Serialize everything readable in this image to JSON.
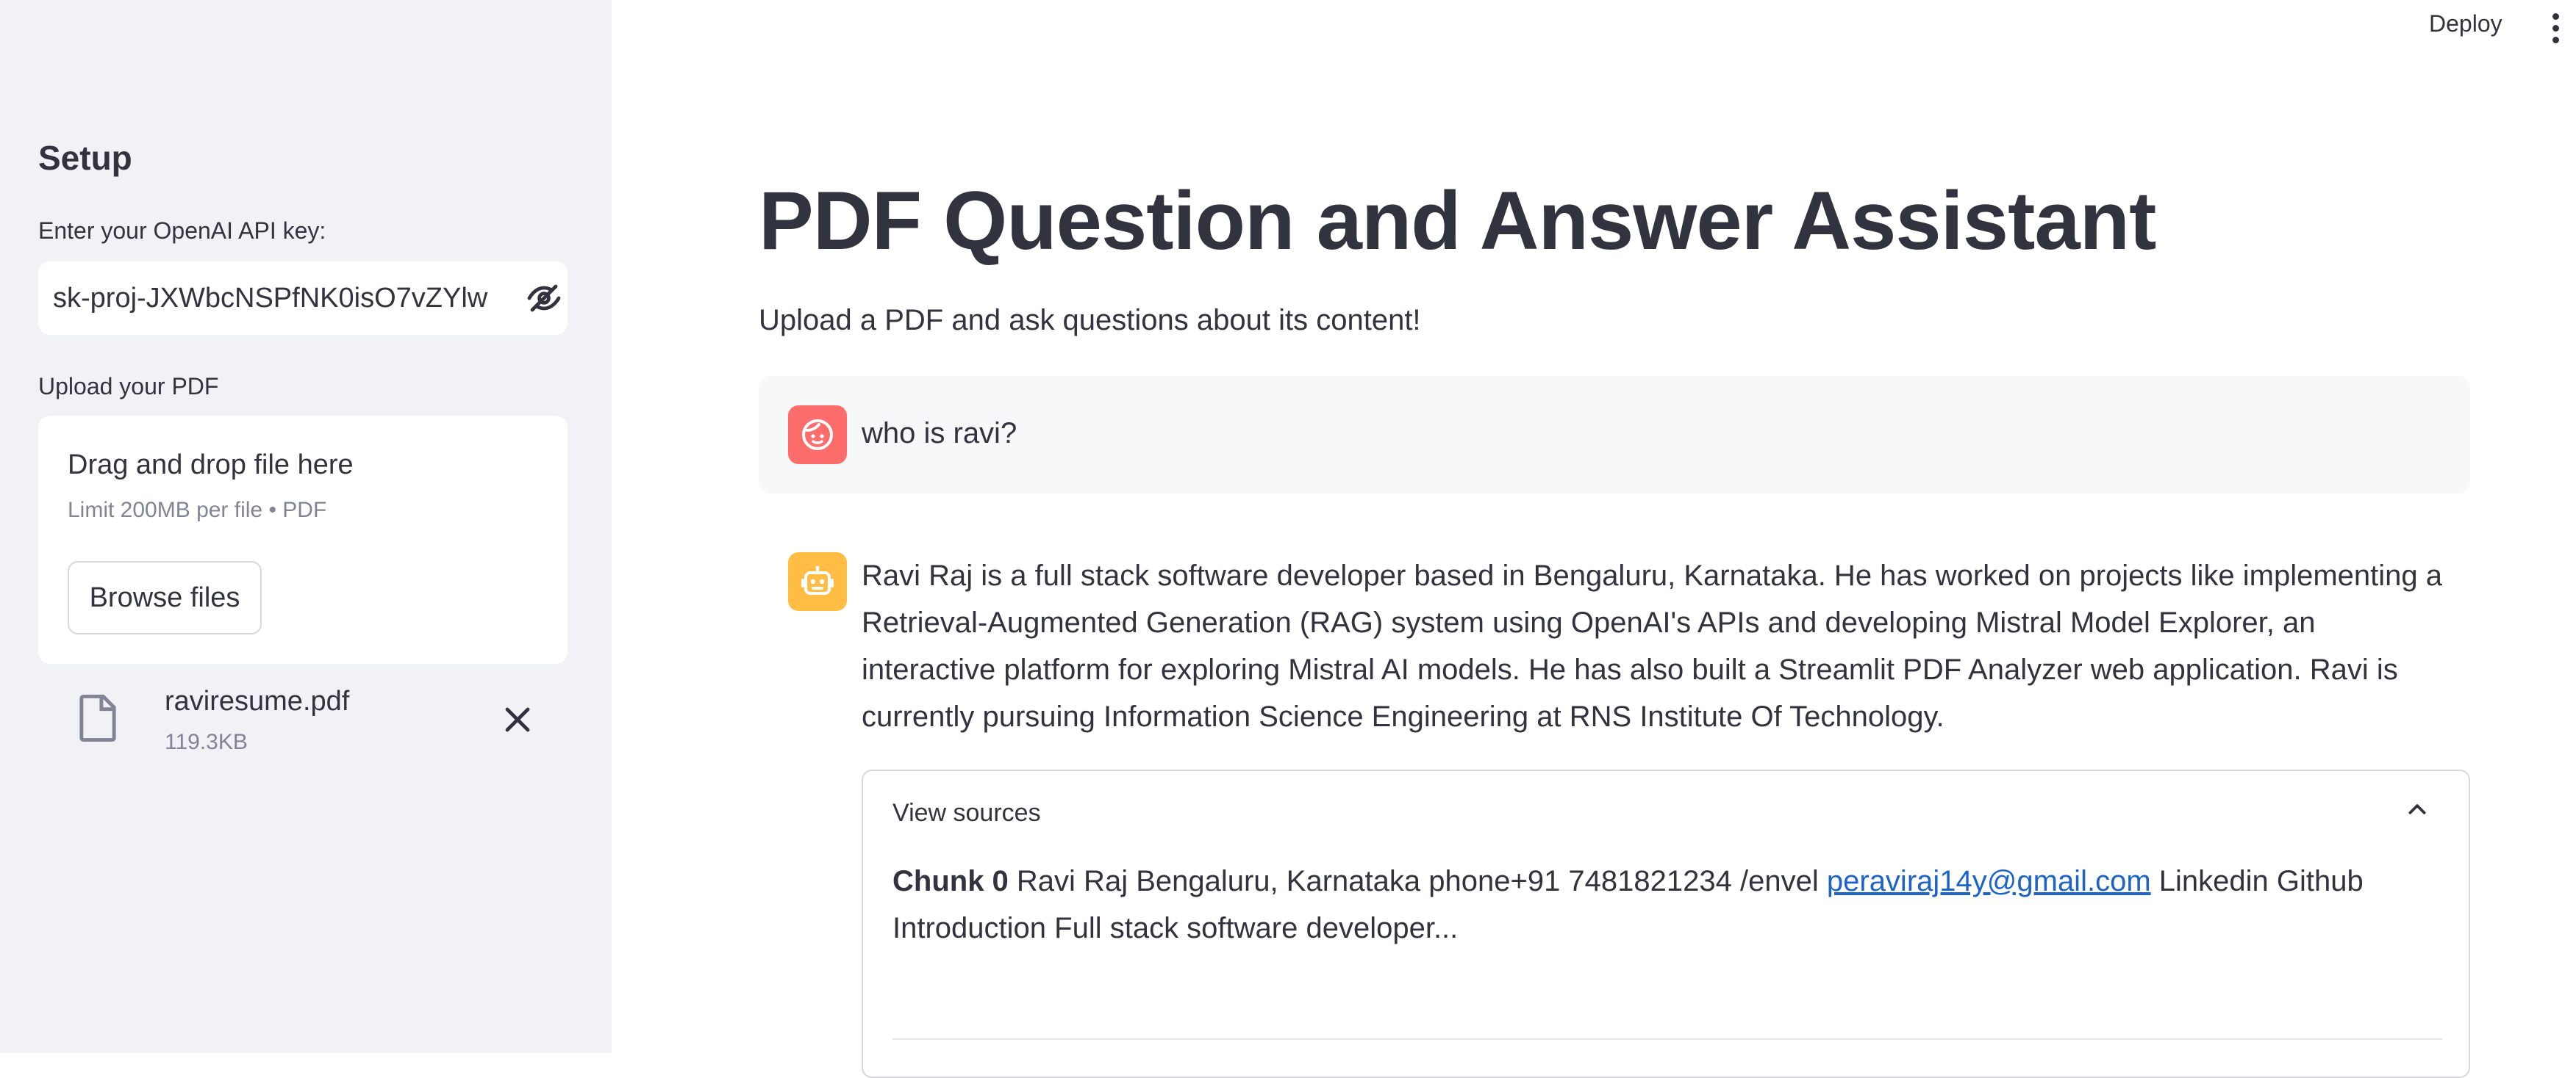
{
  "header": {
    "deploy_label": "Deploy",
    "menu_icon": "kebab-menu-icon"
  },
  "sidebar": {
    "title": "Setup",
    "api_key_label": "Enter your OpenAI API key:",
    "api_key_value": "sk-proj-JXWbcNSPfNK0isO7vZYlw",
    "api_key_visibility_icon": "eye-slash-icon",
    "upload_label": "Upload your PDF",
    "dropzone": {
      "title": "Drag and drop file here",
      "limit": "Limit 200MB per file • PDF",
      "browse_label": "Browse files"
    },
    "uploaded_file": {
      "name": "raviresume.pdf",
      "size": "119.3KB",
      "icon": "file-icon",
      "remove_icon": "close-icon"
    }
  },
  "main": {
    "title": "PDF Question and Answer Assistant",
    "subtitle": "Upload a PDF and ask questions about its content!",
    "messages": [
      {
        "role": "user",
        "avatar_icon": "user-face-icon",
        "avatar_color": "#ff6c6c",
        "text": "who is ravi?"
      },
      {
        "role": "assistant",
        "avatar_icon": "robot-icon",
        "avatar_color": "#ffbd45",
        "text": "Ravi Raj is a full stack software developer based in Bengaluru, Karnataka. He has worked on projects like implementing a Retrieval-Augmented Generation (RAG) system using OpenAI's APIs and developing Mistral Model Explorer, an interactive platform for exploring Mistral AI models. He has also built a Streamlit PDF Analyzer web application. Ravi is currently pursuing Information Science Engineering at RNS Institute Of Technology."
      }
    ],
    "sources": {
      "header": "View sources",
      "expanded": true,
      "chunk_label": "Chunk 0",
      "chunk_text_before": "Ravi Raj Bengaluru, Karnataka phone+91 7481821234 /envel",
      "chunk_link": "peraviraj14y@gmail.com",
      "chunk_text_after": "Linkedin Github Introduction Full stack software developer..."
    }
  },
  "colors": {
    "sidebar_bg": "#f0f2f6",
    "text": "#31333f",
    "muted": "#808495",
    "link": "#1c64c8"
  }
}
